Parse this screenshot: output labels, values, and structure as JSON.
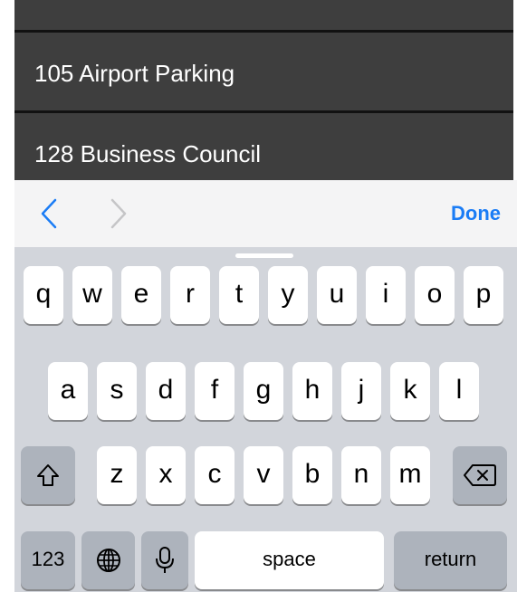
{
  "list": {
    "items": [
      {
        "label": "105 Airport Parking"
      },
      {
        "label": "128 Business Council"
      }
    ]
  },
  "accessory": {
    "done_label": "Done"
  },
  "keyboard": {
    "rows": [
      [
        "q",
        "w",
        "e",
        "r",
        "t",
        "y",
        "u",
        "i",
        "o",
        "p"
      ],
      [
        "a",
        "s",
        "d",
        "f",
        "g",
        "h",
        "j",
        "k",
        "l"
      ],
      [
        "z",
        "x",
        "c",
        "v",
        "b",
        "n",
        "m"
      ]
    ],
    "numbers_label": "123",
    "space_label": "space",
    "return_label": "return",
    "icons": {
      "shift": "shift-icon",
      "delete": "backspace-icon",
      "globe": "globe-icon",
      "mic": "microphone-icon"
    }
  },
  "colors": {
    "list_bg": "#3e3e3e",
    "accent": "#1a7cf5",
    "keyboard_bg": "#d2d5db",
    "special_key": "#adb3bc"
  }
}
